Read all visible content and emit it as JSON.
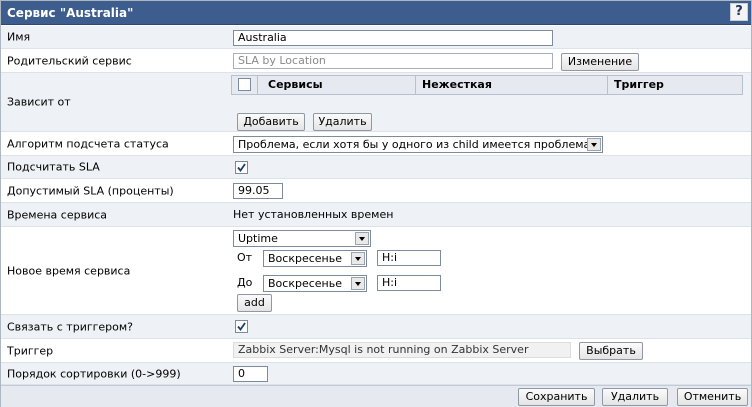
{
  "window": {
    "title": "Сервис \"Australia\"",
    "help_label": "?"
  },
  "fields": {
    "name": {
      "label": "Имя",
      "value": "Australia"
    },
    "parent": {
      "label": "Родительский сервис",
      "placeholder": "SLA by Location",
      "button": "Изменение"
    },
    "depends": {
      "label": "Зависит от",
      "columns": [
        "Сервисы",
        "Нежесткая",
        "Триггер"
      ],
      "add_button": "Добавить",
      "remove_button": "Удалить"
    },
    "algorithm": {
      "label": "Алгоритм подсчета статуса",
      "value": "Проблема, если хотя бы у одного из child имеется проблема"
    },
    "calc_sla": {
      "label": "Подсчитать SLA",
      "checked": true
    },
    "sla": {
      "label": "Допустимый SLA (проценты)",
      "value": "99.05"
    },
    "service_times": {
      "label": "Времена сервиса",
      "value": "Нет установленных времен"
    },
    "new_time": {
      "label": "Новое время сервиса",
      "type_value": "Uptime",
      "from_label": "От",
      "from_day": "Воскресенье",
      "from_time": "H:i",
      "to_label": "До",
      "to_day": "Воскресенье",
      "to_time": "H:i",
      "add_button": "add"
    },
    "link_trigger": {
      "label": "Связать с триггером?",
      "checked": true
    },
    "trigger": {
      "label": "Триггер",
      "value": "Zabbix Server:Mysql is not running on Zabbix Server",
      "button": "Выбрать"
    },
    "sort_order": {
      "label": "Порядок сортировки (0->999)",
      "value": "0"
    }
  },
  "footer": {
    "save": "Сохранить",
    "delete": "Удалить",
    "cancel": "Отменить"
  },
  "colors": {
    "titlebar": "#3d5d8e",
    "row_alt": "#eef1f5",
    "footer": "#e6eaf0"
  }
}
